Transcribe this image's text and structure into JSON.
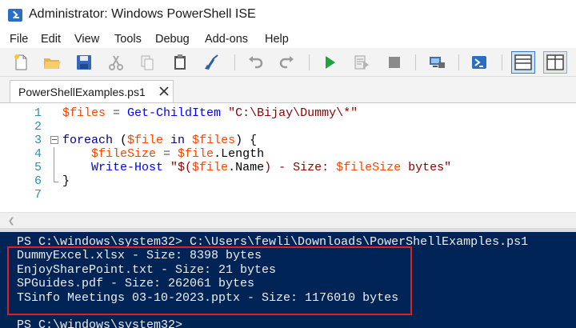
{
  "window": {
    "title": "Administrator: Windows PowerShell ISE"
  },
  "menu": [
    "File",
    "Edit",
    "View",
    "Tools",
    "Debug",
    "Add-ons",
    "Help"
  ],
  "toolbar": {
    "buttons": [
      "new-script",
      "open",
      "save",
      "cut",
      "copy",
      "paste",
      "clear-console",
      "undo",
      "redo",
      "run-script",
      "run-selection",
      "stop",
      "new-remote-tab",
      "start-powershell",
      "show-script-top",
      "show-script-right"
    ]
  },
  "tabs": [
    {
      "label": "PowerShellExamples.ps1",
      "active": true
    }
  ],
  "editor": {
    "lines": [
      {
        "num": "1",
        "tokens": [
          {
            "t": "$files",
            "c": "var"
          },
          {
            "t": " = ",
            "c": "op"
          },
          {
            "t": "Get-ChildItem",
            "c": "cmd"
          },
          {
            "t": " ",
            "c": "pl"
          },
          {
            "t": "\"C:\\Bijay\\Dummy\\*\"",
            "c": "str"
          }
        ]
      },
      {
        "num": "2",
        "tokens": []
      },
      {
        "num": "3",
        "fold": true,
        "tokens": [
          {
            "t": "foreach",
            "c": "kw"
          },
          {
            "t": " (",
            "c": "pl"
          },
          {
            "t": "$file",
            "c": "var"
          },
          {
            "t": " in ",
            "c": "kw"
          },
          {
            "t": "$files",
            "c": "var"
          },
          {
            "t": ") {",
            "c": "pl"
          }
        ]
      },
      {
        "num": "4",
        "tokens": [
          {
            "t": "    ",
            "c": "pl"
          },
          {
            "t": "$fileSize",
            "c": "var"
          },
          {
            "t": " = ",
            "c": "op"
          },
          {
            "t": "$file",
            "c": "var"
          },
          {
            "t": ".Length",
            "c": "mem"
          }
        ]
      },
      {
        "num": "5",
        "tokens": [
          {
            "t": "    ",
            "c": "pl"
          },
          {
            "t": "Write-Host",
            "c": "cmd"
          },
          {
            "t": " \"$(",
            "c": "str"
          },
          {
            "t": "$file",
            "c": "var"
          },
          {
            "t": ".Name",
            "c": "mem"
          },
          {
            "t": ") - Size: ",
            "c": "str"
          },
          {
            "t": "$fileSize",
            "c": "var"
          },
          {
            "t": " bytes\"",
            "c": "str"
          }
        ]
      },
      {
        "num": "6",
        "tokens": [
          {
            "t": "}",
            "c": "pl"
          }
        ]
      },
      {
        "num": "7",
        "tokens": []
      }
    ]
  },
  "console": {
    "lines": [
      "PS C:\\windows\\system32> C:\\Users\\fewli\\Downloads\\PowerShellExamples.ps1",
      "DummyExcel.xlsx - Size: 8398 bytes",
      "EnjoySharePoint.txt - Size: 21 bytes",
      "SPGuides.pdf - Size: 262061 bytes",
      "TSinfo Meetings 03-10-2023.pptx - Size: 1176010 bytes",
      "",
      "PS C:\\windows\\system32>"
    ]
  },
  "colors": {
    "console_bg": "#012456",
    "highlight": "#e02020",
    "variable": "#ff4500",
    "cmdlet": "#0000ff",
    "string": "#8b0000",
    "keyword": "#00008b"
  }
}
